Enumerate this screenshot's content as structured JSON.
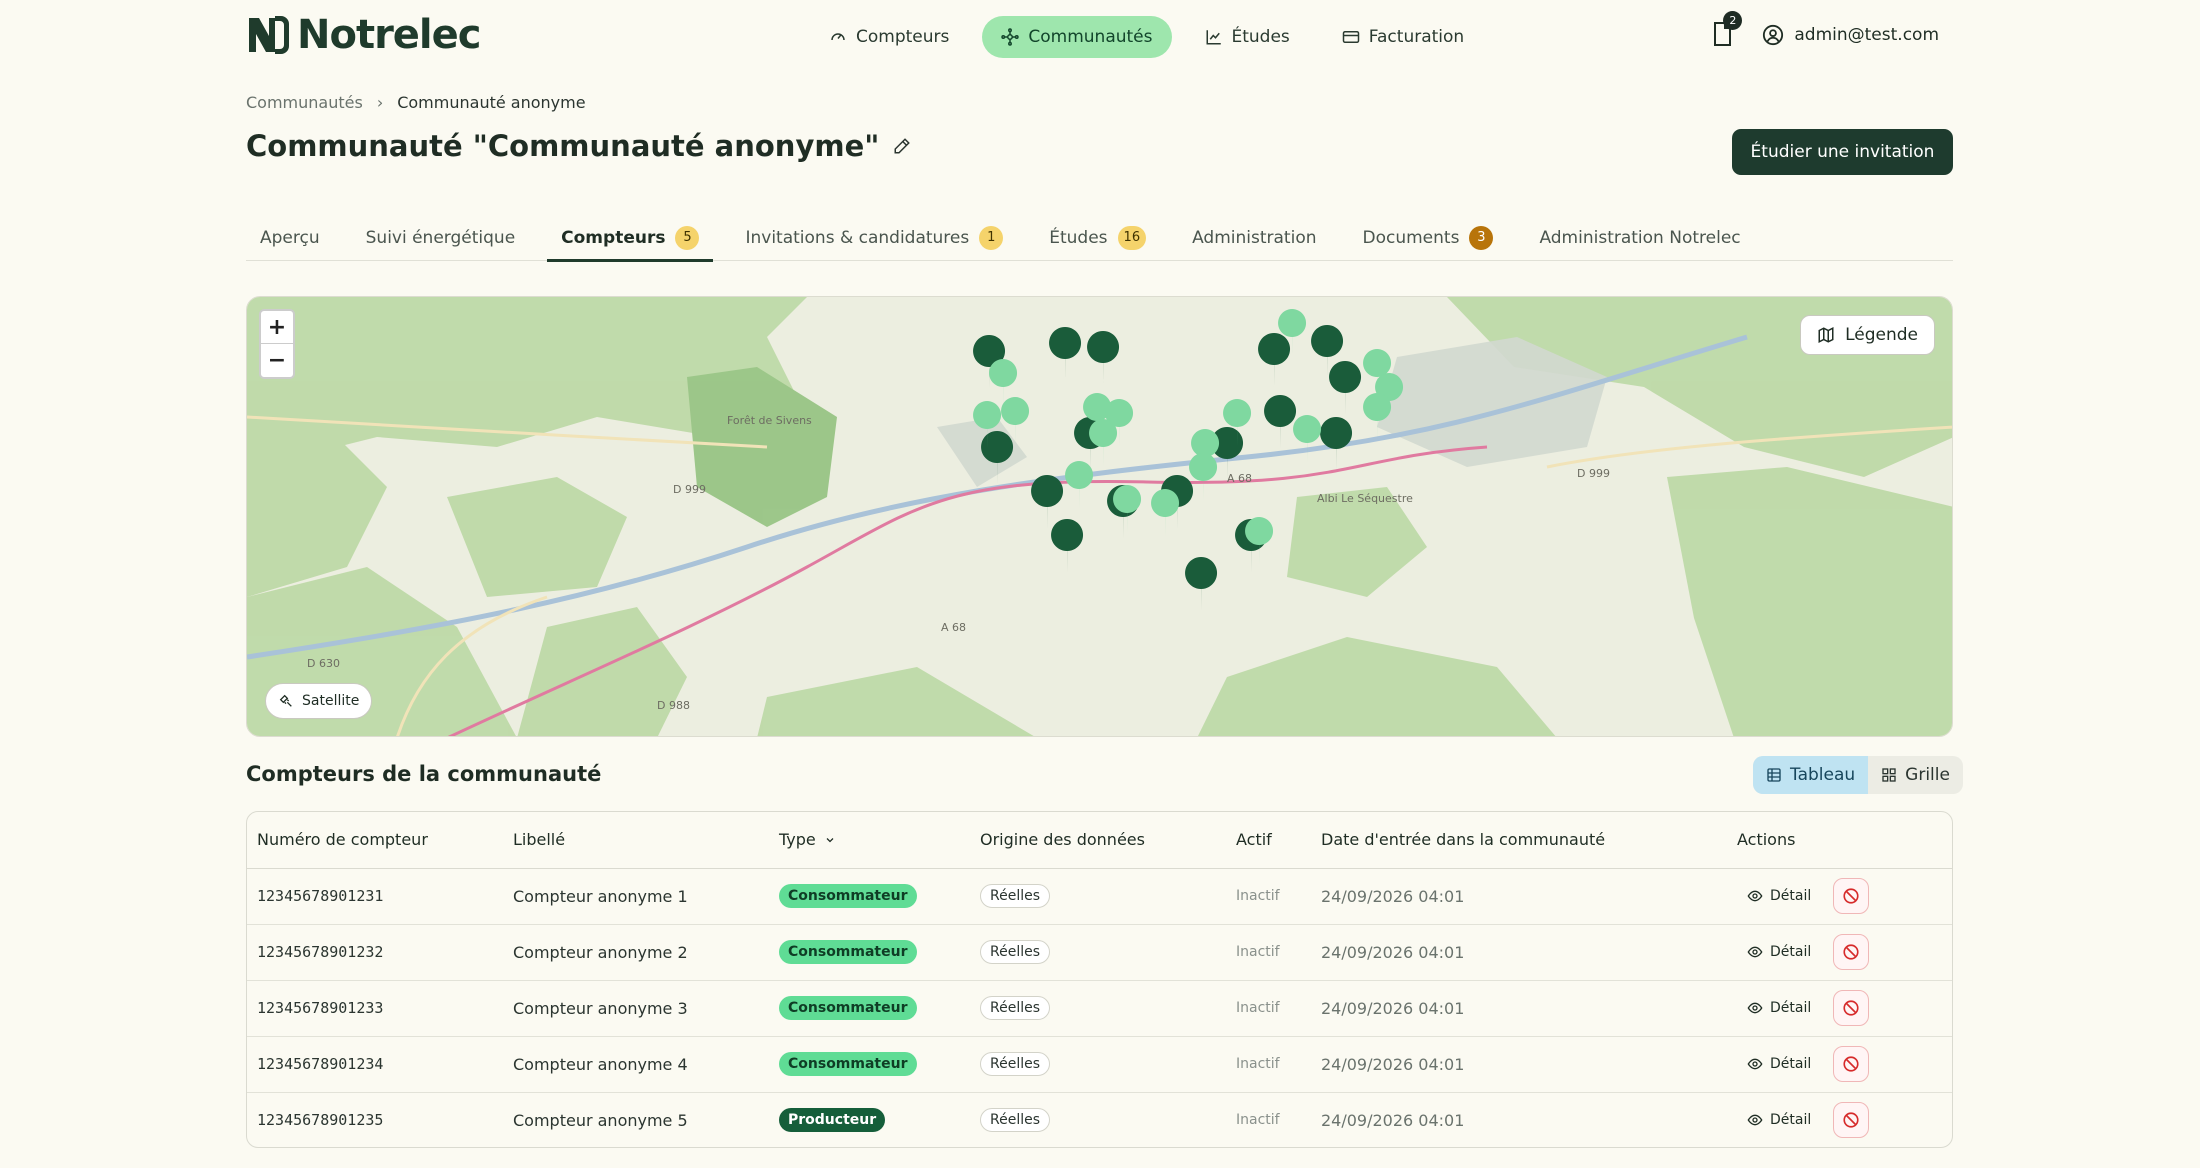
{
  "app": {
    "logo_text": "Notrelec"
  },
  "nav": {
    "items": [
      {
        "label": "Compteurs",
        "icon": "gauge-icon"
      },
      {
        "label": "Communautés",
        "icon": "network-icon"
      },
      {
        "label": "Études",
        "icon": "chart-icon"
      },
      {
        "label": "Facturation",
        "icon": "credit-card-icon"
      }
    ]
  },
  "notifications": {
    "count": "2"
  },
  "user": {
    "email": "admin@test.com"
  },
  "breadcrumb": {
    "parent": "Communautés",
    "separator": "›",
    "current": "Communauté anonyme"
  },
  "page": {
    "title": "Communauté \"Communauté anonyme\"",
    "invite_button": "Étudier une invitation"
  },
  "tabs": [
    {
      "label": "Aperçu",
      "badge": ""
    },
    {
      "label": "Suivi énergétique",
      "badge": ""
    },
    {
      "label": "Compteurs",
      "badge": "5"
    },
    {
      "label": "Invitations & candidatures",
      "badge": "1"
    },
    {
      "label": "Études",
      "badge": "16"
    },
    {
      "label": "Administration",
      "badge": ""
    },
    {
      "label": "Documents",
      "badge": "3"
    },
    {
      "label": "Administration Notrelec",
      "badge": ""
    }
  ],
  "map": {
    "zoom_in": "+",
    "zoom_out": "−",
    "legend_button": "Légende",
    "satellite_button": "Satellite",
    "labels": [
      "Forêt de Sivens",
      "D 999",
      "D 999",
      "D 630",
      "A 68",
      "D 988",
      "A 68",
      "Albi Le Séquestre"
    ]
  },
  "meters": {
    "section_title": "Compteurs de la communauté",
    "view_table": "Tableau",
    "view_grid": "Grille",
    "columns": [
      "Numéro de compteur",
      "Libellé",
      "Type",
      "Origine des données",
      "Actif",
      "Date d'entrée dans la communauté",
      "Actions"
    ],
    "rows": [
      {
        "number": "12345678901231",
        "label": "Compteur anonyme 1",
        "type": "Consommateur",
        "origin": "Réelles",
        "active": "Inactif",
        "date": "24/09/2026 04:01",
        "detail": "Détail"
      },
      {
        "number": "12345678901232",
        "label": "Compteur anonyme 2",
        "type": "Consommateur",
        "origin": "Réelles",
        "active": "Inactif",
        "date": "24/09/2026 04:01",
        "detail": "Détail"
      },
      {
        "number": "12345678901233",
        "label": "Compteur anonyme 3",
        "type": "Consommateur",
        "origin": "Réelles",
        "active": "Inactif",
        "date": "24/09/2026 04:01",
        "detail": "Détail"
      },
      {
        "number": "12345678901234",
        "label": "Compteur anonyme 4",
        "type": "Consommateur",
        "origin": "Réelles",
        "active": "Inactif",
        "date": "24/09/2026 04:01",
        "detail": "Détail"
      },
      {
        "number": "12345678901235",
        "label": "Compteur anonyme 5",
        "type": "Producteur",
        "origin": "Réelles",
        "active": "Inactif",
        "date": "24/09/2026 04:01",
        "detail": "Détail"
      }
    ]
  },
  "colors": {
    "accent": "#9ee6ad",
    "brand_dark": "#1e3b2e",
    "consumer": "#5fdc95",
    "producer": "#155e3a",
    "badge": "#f5d36b"
  }
}
